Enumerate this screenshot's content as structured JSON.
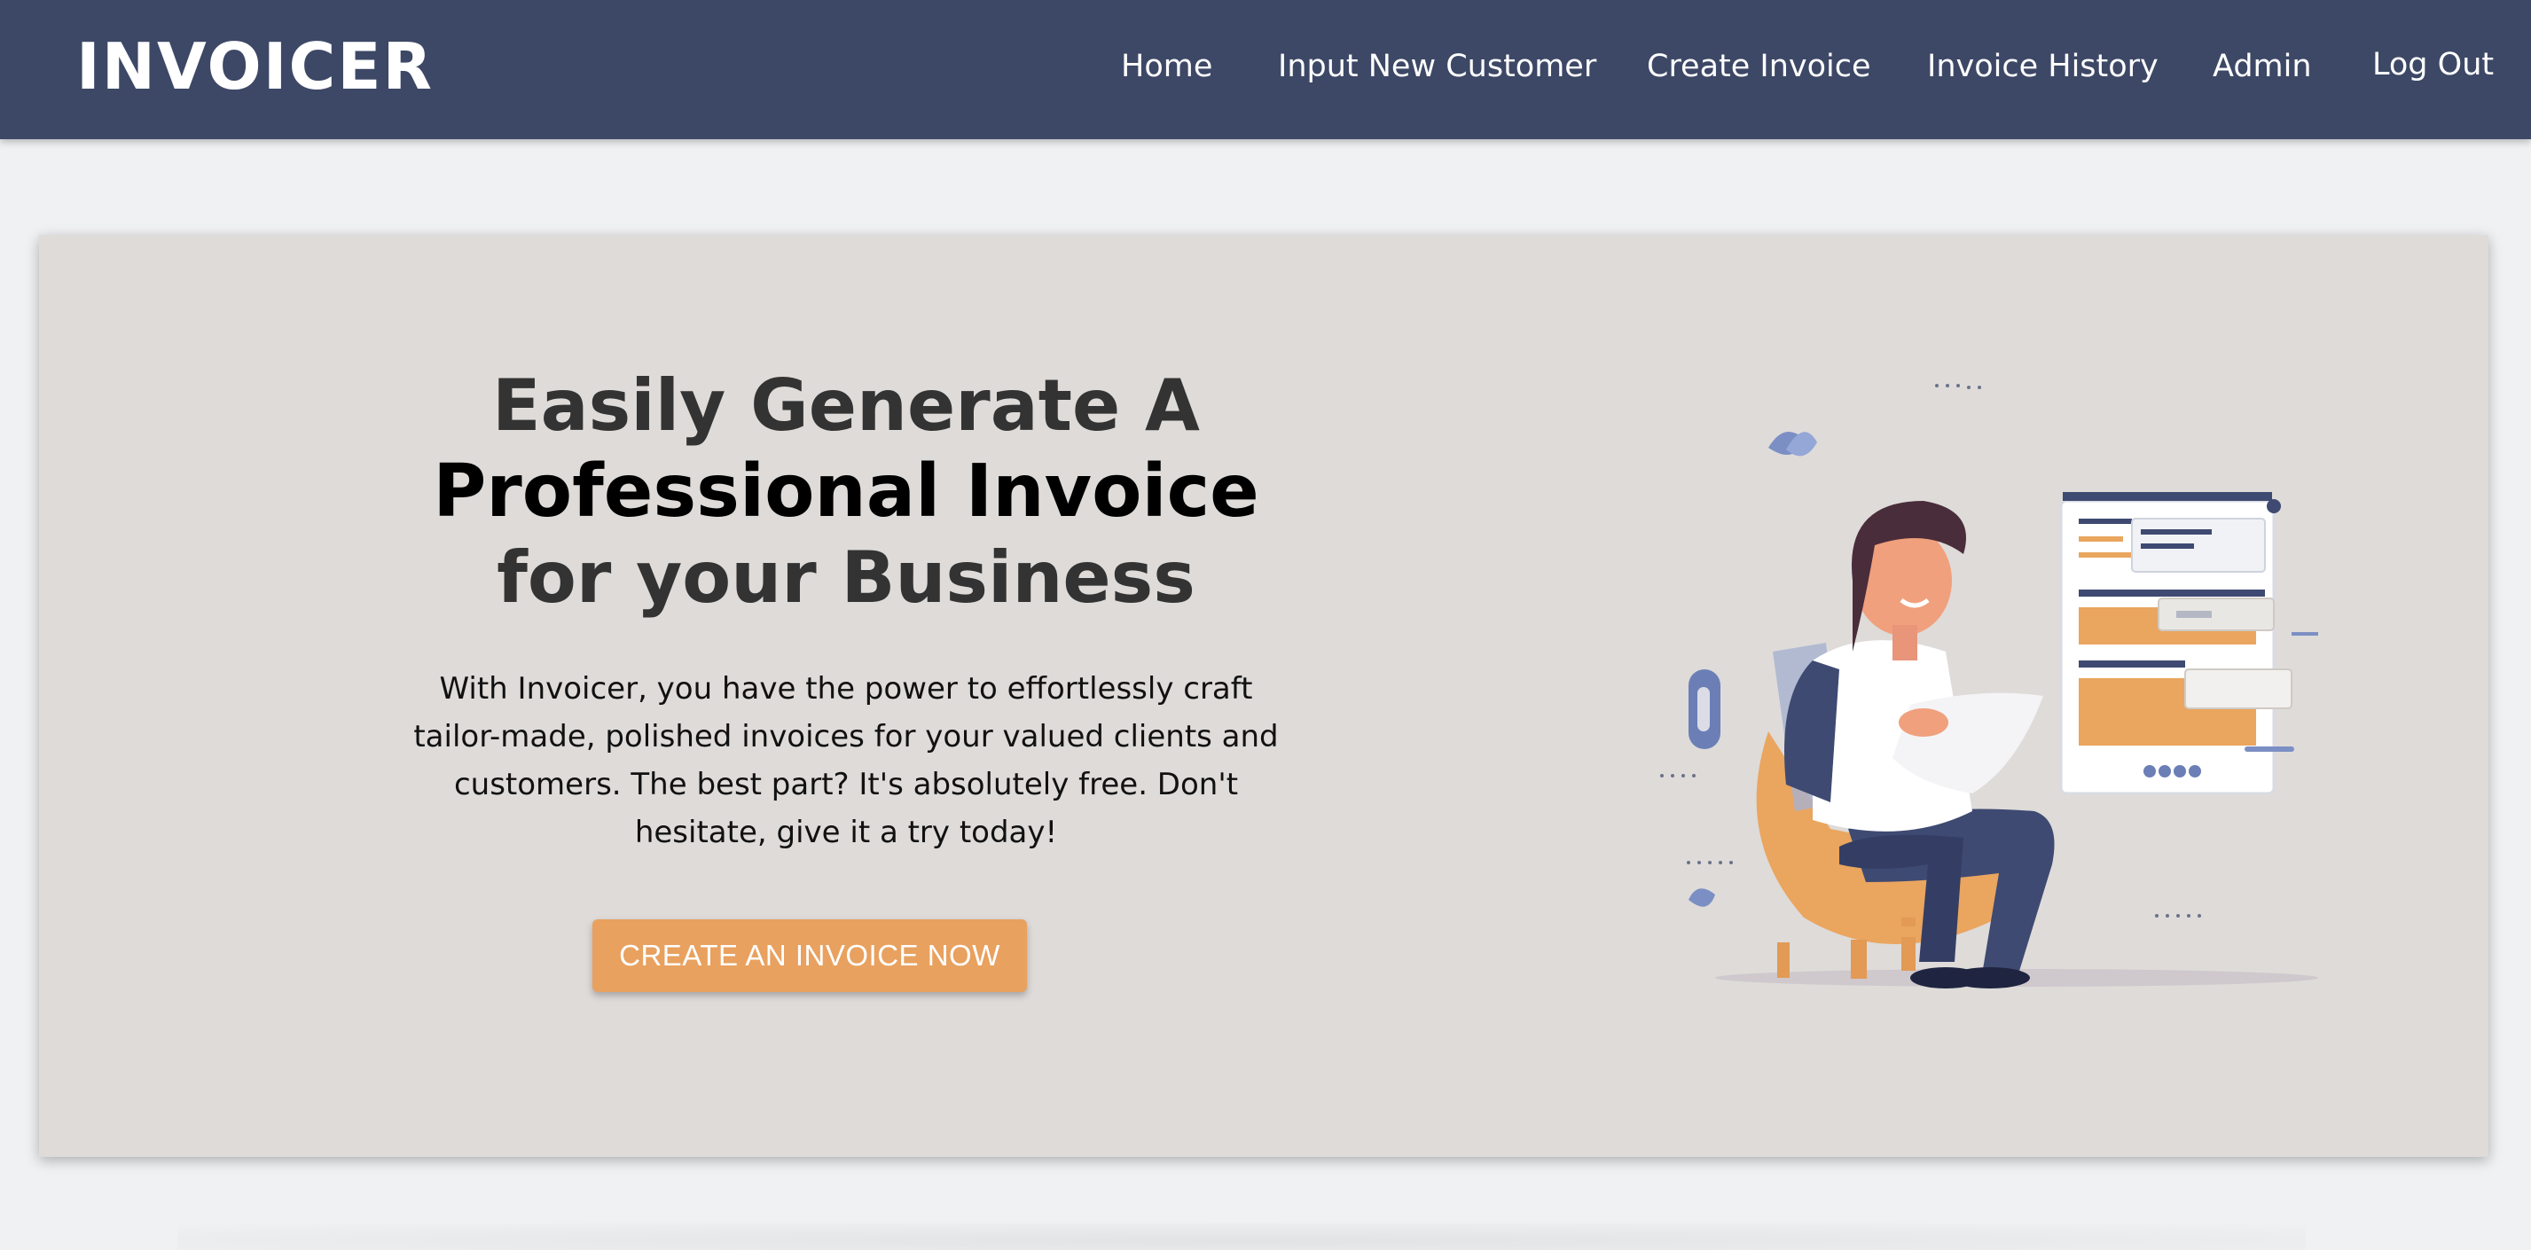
{
  "brand": {
    "name": "INVOICER"
  },
  "nav": {
    "items": [
      {
        "label": "Home"
      },
      {
        "label": "Input New Customer"
      },
      {
        "label": "Create Invoice"
      },
      {
        "label": "Invoice History"
      },
      {
        "label": "Admin"
      },
      {
        "label": "Log Out"
      }
    ]
  },
  "hero": {
    "headline_line1": "Easily Generate A",
    "headline_line2": "Professional Invoice",
    "headline_line3": "for your Business",
    "description": "With Invoicer, you have the power to effortlessly craft tailor-made, polished invoices for your valued clients and customers. The best part? It's absolutely free. Don't hesitate, give it a try today!",
    "cta_label": "CREATE AN INVOICE NOW"
  },
  "colors": {
    "navbar": "#3d4866",
    "hero_background": "#dedbd9",
    "page_background": "#f0f1f3",
    "accent": "#e8a15f"
  },
  "illustration": {
    "icon": "person-reviewing-invoice-illustration"
  }
}
